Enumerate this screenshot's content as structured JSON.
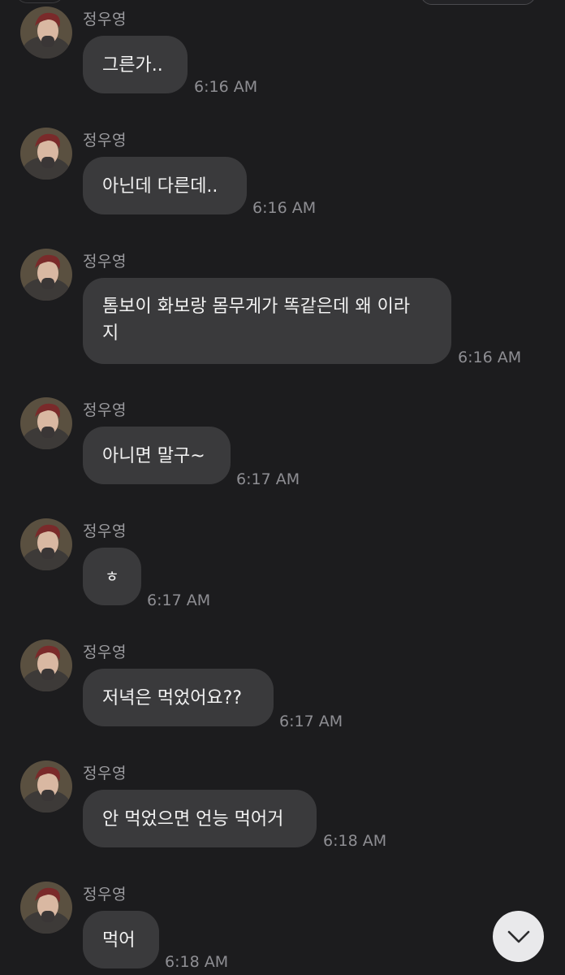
{
  "chat": {
    "messages": [
      {
        "sender": "정우영",
        "text": "그른가..",
        "time": "6:16 AM"
      },
      {
        "sender": "정우영",
        "text": "아닌데 다른데..",
        "time": "6:16 AM"
      },
      {
        "sender": "정우영",
        "text": "톰보이 화보랑 몸무게가 똑같은데 왜 이라\n지",
        "time": "6:16 AM"
      },
      {
        "sender": "정우영",
        "text": "아니면 말구~",
        "time": "6:17 AM"
      },
      {
        "sender": "정우영",
        "text": "ㅎ",
        "time": "6:17 AM"
      },
      {
        "sender": "정우영",
        "text": "저녁은 먹었어요??",
        "time": "6:17 AM"
      },
      {
        "sender": "정우영",
        "text": "안 먹었으면 언능 먹어거",
        "time": "6:18 AM"
      },
      {
        "sender": "정우영",
        "text": "먹어",
        "time": "6:18 AM"
      }
    ]
  },
  "controls": {
    "scroll_down_icon": "chevron-down-icon"
  },
  "colors": {
    "background": "#1c1c1e",
    "bubble": "#3a3a3c",
    "sender_text": "#9a9a9e",
    "timestamp": "#8e8e93",
    "scroll_button": "#e9e9eb"
  }
}
